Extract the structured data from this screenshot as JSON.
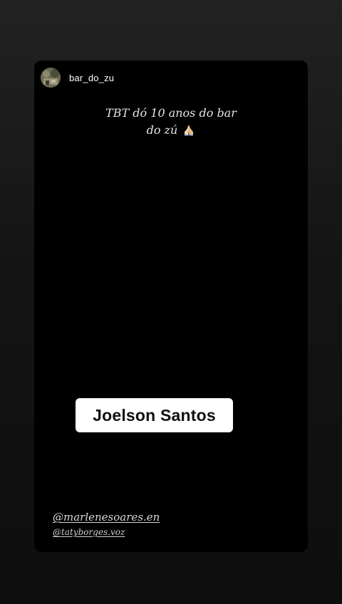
{
  "story": {
    "username": "bar_do_zu",
    "avatar_icon": "profile-photo-icon",
    "caption_line1": "TBT dó 10 anos do bar",
    "caption_line2": "do zú",
    "caption_emoji_icon": "praying-hands-icon",
    "name_sticker": "Joelson Santos",
    "mentions": [
      "@marlenesoares.en",
      "@tatyborges.voz"
    ]
  },
  "colors": {
    "background": "#141414",
    "card": "#000000",
    "sticker": "#ffffff",
    "sticker_text": "#111111",
    "text": "#ffffff"
  }
}
